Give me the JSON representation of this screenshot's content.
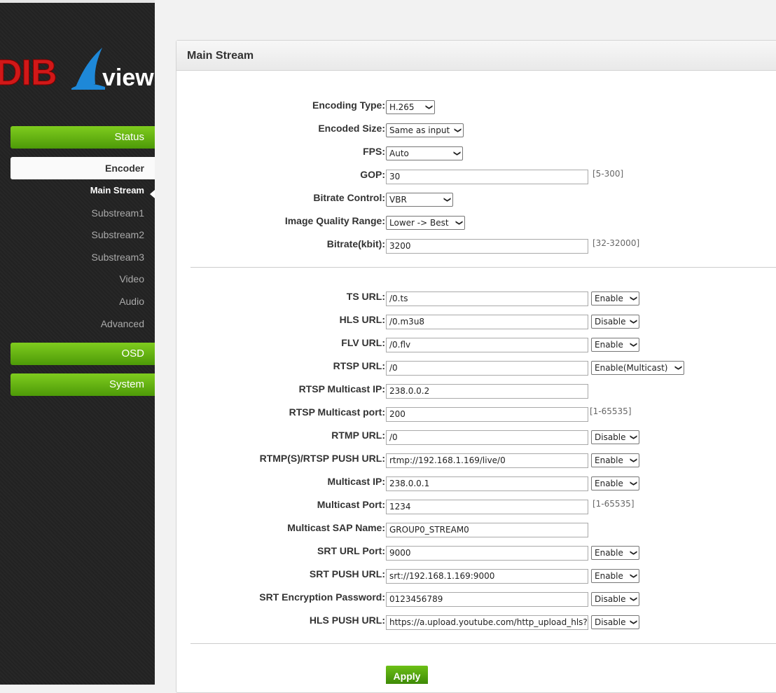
{
  "logo": {
    "brand_part1": "DIB",
    "brand_part2": "view"
  },
  "sidebar": {
    "status_label": "Status",
    "encoder_label": "Encoder",
    "encoder_items": [
      "Main Stream",
      "Substream1",
      "Substream2",
      "Substream3",
      "Video",
      "Audio",
      "Advanced"
    ],
    "osd_label": "OSD",
    "system_label": "System"
  },
  "panel": {
    "title": "Main Stream"
  },
  "encoding": {
    "encoding_type": {
      "label": "Encoding Type:",
      "value": "H.265"
    },
    "encoded_size": {
      "label": "Encoded Size:",
      "value": "Same as input"
    },
    "fps": {
      "label": "FPS:",
      "value": "Auto"
    },
    "gop": {
      "label": "GOP:",
      "value": "30",
      "hint": "[5-300]"
    },
    "bitrate_control": {
      "label": "Bitrate Control:",
      "value": "VBR"
    },
    "image_quality_range": {
      "label": "Image Quality Range:",
      "value": "Lower -> Best"
    },
    "bitrate": {
      "label": "Bitrate(kbit):",
      "value": "3200",
      "hint": "[32-32000]"
    }
  },
  "urls": {
    "ts": {
      "label": "TS URL:",
      "value": "/0.ts",
      "state": "Enable"
    },
    "hls": {
      "label": "HLS URL:",
      "value": "/0.m3u8",
      "state": "Disable"
    },
    "flv": {
      "label": "FLV URL:",
      "value": "/0.flv",
      "state": "Enable"
    },
    "rtsp": {
      "label": "RTSP URL:",
      "value": "/0",
      "state": "Enable(Multicast)"
    },
    "rtsp_multicast_ip": {
      "label": "RTSP Multicast IP:",
      "value": "238.0.0.2"
    },
    "rtsp_multicast_port": {
      "label": "RTSP Multicast port:",
      "value": "200",
      "hint": "[1-65535]"
    },
    "rtmp": {
      "label": "RTMP URL:",
      "value": "/0",
      "state": "Disable"
    },
    "rtmp_push": {
      "label": "RTMP(S)/RTSP PUSH URL:",
      "value": "rtmp://192.168.1.169/live/0",
      "state": "Enable"
    },
    "multicast_ip": {
      "label": "Multicast IP:",
      "value": "238.0.0.1",
      "state": "Enable"
    },
    "multicast_port": {
      "label": "Multicast Port:",
      "value": "1234",
      "hint": "[1-65535]"
    },
    "multicast_sap_name": {
      "label": "Multicast SAP Name:",
      "value": "GROUP0_STREAM0"
    },
    "srt_url_port": {
      "label": "SRT URL Port:",
      "value": "9000",
      "state": "Enable"
    },
    "srt_push": {
      "label": "SRT PUSH URL:",
      "value": "srt://192.168.1.169:9000",
      "state": "Enable"
    },
    "srt_password": {
      "label": "SRT Encryption Password:",
      "value": "0123456789",
      "state": "Disable"
    },
    "hls_push": {
      "label": "HLS PUSH URL:",
      "value": "https://a.upload.youtube.com/http_upload_hls?c",
      "state": "Disable"
    }
  },
  "apply_label": "Apply"
}
